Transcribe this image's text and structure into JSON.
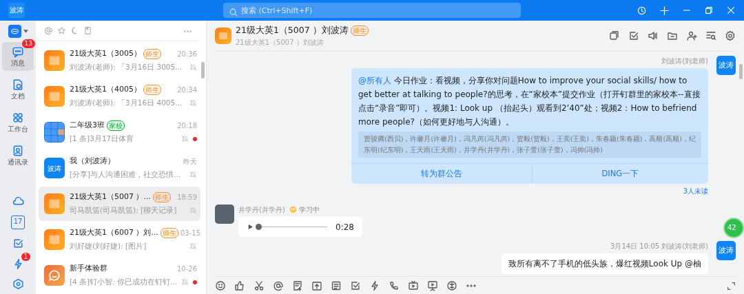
{
  "topbar": {
    "avatar_text": "波涛",
    "search": {
      "placeholder": "搜索 (Ctrl+Shift+F)"
    }
  },
  "rail": {
    "items": [
      {
        "label": "消息",
        "badge": "13",
        "selected": true
      },
      {
        "label": "文档",
        "selected": false
      },
      {
        "label": "工作台",
        "selected": false
      },
      {
        "label": "通讯录",
        "selected": false
      }
    ],
    "calendar_date": "17",
    "ding_badge": "1"
  },
  "conversations": [
    {
      "avatar": {
        "kind": "book"
      },
      "title": "21级大英1（3005）",
      "tag": {
        "text": "师生",
        "color": "#ff8f1f"
      },
      "time": "20:36",
      "preview": "刘波涛(老师): 「3月16日 3005...",
      "muted": true,
      "unread": false,
      "selected": false
    },
    {
      "avatar": {
        "kind": "book"
      },
      "title": "21级大英1（4005）",
      "tag": {
        "text": "师生",
        "color": "#ff8f1f"
      },
      "time": "20:34",
      "preview": "刘波涛(老师): 「3月16日 4005...",
      "muted": true,
      "unread": false,
      "selected": false
    },
    {
      "avatar": {
        "kind": "grid"
      },
      "title": "二年级3班",
      "tag": {
        "text": "家校",
        "color": "#00b42a"
      },
      "time": "20:18",
      "preview": "[1 条]3月17日体育",
      "muted": true,
      "unread": true,
      "selected": false
    },
    {
      "avatar": {
        "kind": "name",
        "text": "波涛"
      },
      "title": "我（刘波涛）",
      "time": "昨天",
      "preview": "[分享]与人沟通困难，社交恐惧...",
      "muted": true,
      "unread": false,
      "selected": false
    },
    {
      "avatar": {
        "kind": "book"
      },
      "title": "21级大英1（5007 ）...",
      "tag": {
        "text": "师生",
        "color": "#ff8f1f"
      },
      "time": "18:59",
      "preview": "司马凯笛(司马凯笛): [聊天记录]",
      "muted": true,
      "unread": false,
      "selected": true
    },
    {
      "avatar": {
        "kind": "book"
      },
      "title": "21级大英1（6007 ）刘...",
      "tag": {
        "text": "师生",
        "color": "#ff8f1f"
      },
      "time": "03-15",
      "preview": "刘好婕(刘好婕): [图片]",
      "muted": true,
      "unread": false,
      "selected": false
    },
    {
      "avatar": {
        "kind": "bot"
      },
      "title": "新手体验群",
      "time": "10-26",
      "preview": "[4 条]钉小智: 你已成功在钉钉...",
      "muted": true,
      "unread": true,
      "selected": false
    }
  ],
  "chat": {
    "title": "21级大英1（5007 ）刘波涛",
    "tag": {
      "text": "师生",
      "color": "#ff8f1f"
    },
    "subtitle": "21级大英1（5007 ）刘波涛",
    "messages": [
      {
        "kind": "notice",
        "sender": "刘波涛(刘老师)",
        "avatar_text": "波涛",
        "mention": "@所有人",
        "text": "今日作业：看视频，分享你对问题How to improve your social skills/ how to get better at talking to people?的思考，在“家校本”提交作业（打开钉群里的家校本--直接点击“录音”即可）。视频1: Look up （抬起头）观看到2’40”处；视频2：How to befriend more people?（如何更好地与人沟通）。",
        "readers": "贾骏腾(西贝)，许馨月(许馨月)，冯凡芮(冯凡芮)，贾毅(贾毅)，王奕(王奕)，朱春颖(朱春颖)，高顺(高顺)，纪东明(纪东明)，王天雨(王天雨)，井学丹(井学丹)，张子萱(张子萱)，冯帅(冯帅)",
        "actions": [
          "转为群公告",
          "DING一下"
        ],
        "unread": "3人未读"
      },
      {
        "kind": "voice",
        "sender": "井学丹(井学丹)",
        "status": "学习中",
        "duration": "0:28",
        "level": 0.0
      },
      {
        "kind": "text",
        "time": "3月14日 10:05",
        "sender": "刘波涛(刘老师)",
        "avatar_text": "波涛",
        "text": "致所有离不了手机的低头族，爆红视频Look Up @柚"
      }
    ]
  },
  "floating_badge": "42"
}
